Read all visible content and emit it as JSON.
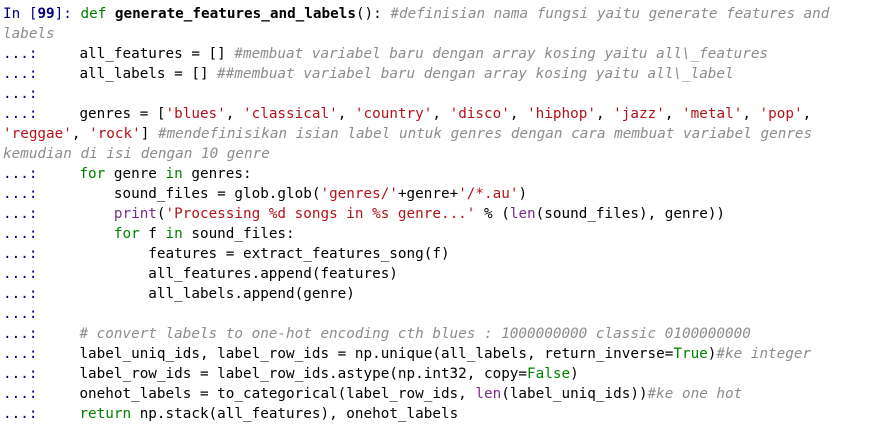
{
  "prompt": {
    "label": "In [",
    "number": "99",
    "close": "]:",
    "continuation": "...:"
  },
  "colors": {
    "keyword": "#008000",
    "builtin": "#7a2d8a",
    "string": "#b5121b",
    "comment": "#8c8c8c",
    "prompt": "#000080"
  },
  "lines": [
    {
      "text": " def "
    },
    {
      "text": "generate_features_and_labels"
    },
    {
      "text": "(): "
    },
    {
      "text": "#definisian nama fungsi yaitu generate features and"
    },
    {
      "text": "labels"
    },
    {
      "text": "all_features = [] "
    },
    {
      "text": "#membuat variabel baru dengan array kosing yaitu all\\_features"
    },
    {
      "text": "all_labels = [] "
    },
    {
      "text": "##membuat variabel baru dengan array kosing yaitu all\\_label"
    },
    {
      "text": "genres = ["
    },
    {
      "text": "'blues'"
    },
    {
      "text": ", "
    },
    {
      "text": "'classical'"
    },
    {
      "text": "'country'"
    },
    {
      "text": "'disco'"
    },
    {
      "text": "'hiphop'"
    },
    {
      "text": "'jazz'"
    },
    {
      "text": "'metal'"
    },
    {
      "text": "'pop'"
    },
    {
      "text": "'reggae'"
    },
    {
      "text": "'rock'"
    },
    {
      "text": "] "
    },
    {
      "text": "#mendefinisikan isian label untuk genres dengan cara membuat variabel genres"
    },
    {
      "text": "kemudian di isi dengan 10 genre"
    },
    {
      "text": "for"
    },
    {
      "text": " genre "
    },
    {
      "text": "in"
    },
    {
      "text": " genres:"
    },
    {
      "text": "sound_files = glob.glob("
    },
    {
      "text": "'genres/'"
    },
    {
      "text": "+genre+"
    },
    {
      "text": "'/*.au'"
    },
    {
      "text": ")"
    },
    {
      "text": "print"
    },
    {
      "text": "("
    },
    {
      "text": "'Processing %d songs in %s genre...'"
    },
    {
      "text": " % ("
    },
    {
      "text": "len"
    },
    {
      "text": "(sound_files), genre))"
    },
    {
      "text": " f "
    },
    {
      "text": " sound_files:"
    },
    {
      "text": "features = extract_features_song(f)"
    },
    {
      "text": "all_features.append(features)"
    },
    {
      "text": "all_labels.append(genre)"
    },
    {
      "text": "# convert labels to one-hot encoding cth blues : 1000000000 classic 0100000000"
    },
    {
      "text": "label_uniq_ids, label_row_ids = np.unique(all_labels, return_inverse="
    },
    {
      "text": "True"
    },
    {
      "text": "#ke integer"
    },
    {
      "text": "label_row_ids = label_row_ids.astype(np.int32, copy="
    },
    {
      "text": "False"
    },
    {
      "text": "onehot_labels = to_categorical(label_row_ids, "
    },
    {
      "text": "(label_uniq_ids))"
    },
    {
      "text": "#ke one hot"
    },
    {
      "text": "return"
    },
    {
      "text": " np.stack(all_features), onehot_labels"
    }
  ]
}
